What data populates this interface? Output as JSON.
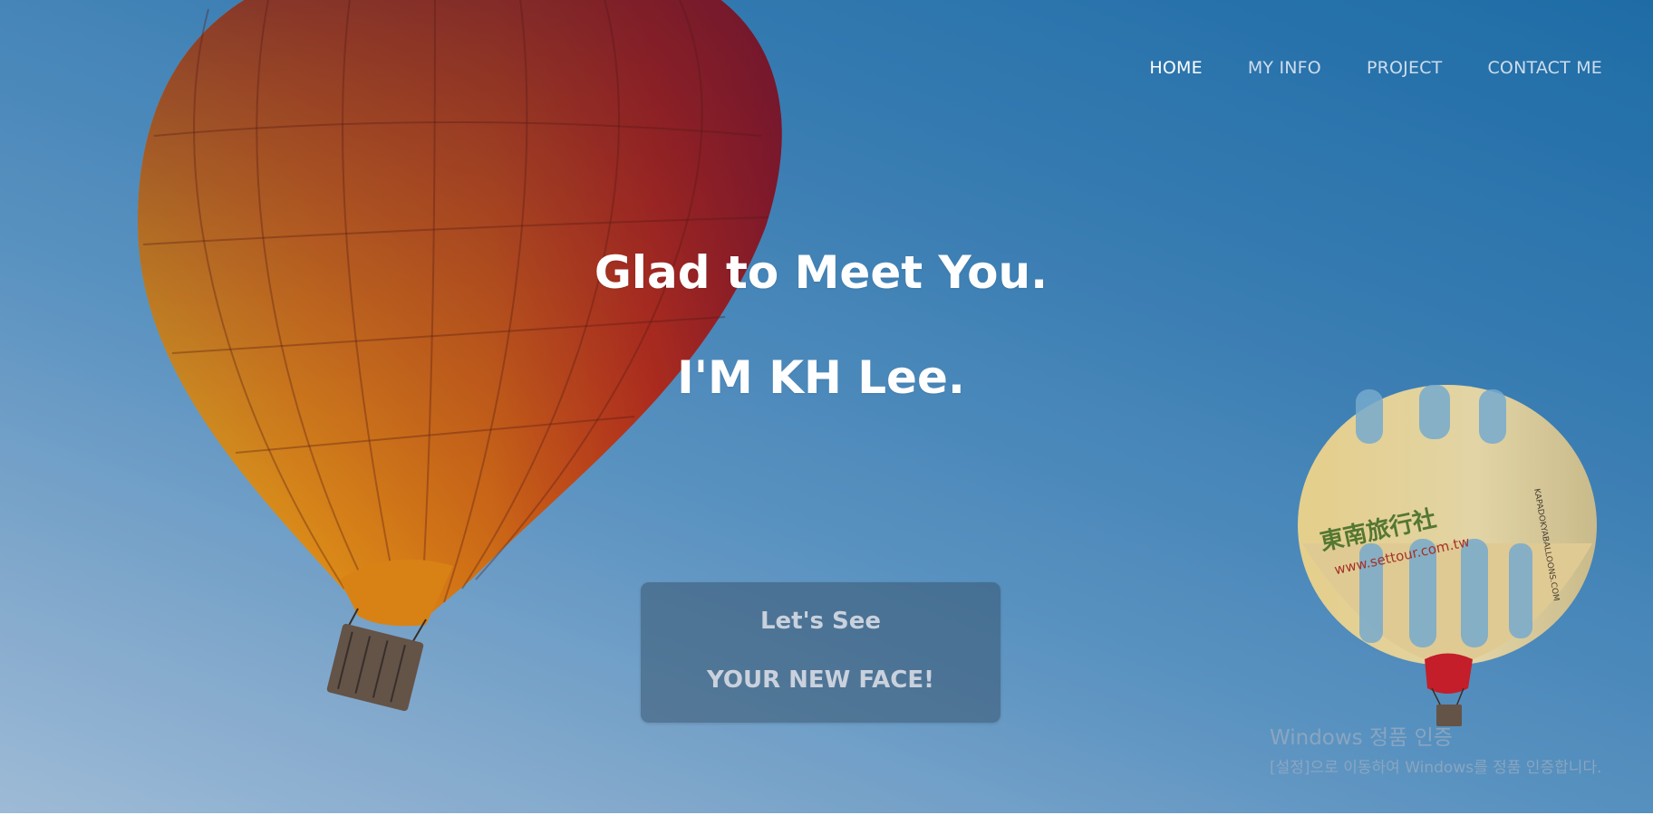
{
  "nav": {
    "items": [
      {
        "label": "HOME",
        "active": true
      },
      {
        "label": "MY INFO",
        "active": false
      },
      {
        "label": "PROJECT",
        "active": false
      },
      {
        "label": "CONTACT ME",
        "active": false
      }
    ]
  },
  "hero": {
    "line1": "Glad to Meet You.",
    "line2": "I'M KH Lee."
  },
  "cta": {
    "line1": "Let's See",
    "line2": "YOUR NEW FACE!"
  },
  "balloon_small": {
    "lettering": [
      "東南旅行社",
      "www.settour.com.tw",
      "KAPADOKYABALLOONS.COM"
    ]
  },
  "watermark": {
    "title": "Windows 정품 인증",
    "subtitle": "[설정]으로 이동하여 Windows를 정품 인증합니다."
  },
  "colors": {
    "sky_top": "#1f6ea8",
    "sky_bottom": "#a9c3dc",
    "text": "#ffffff",
    "button_bg": "#385670"
  }
}
